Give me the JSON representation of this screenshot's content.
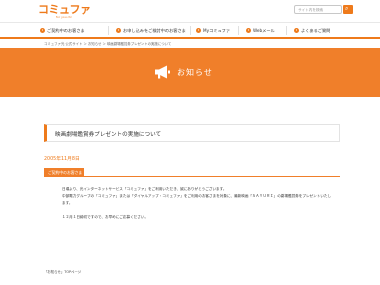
{
  "header": {
    "logo_text": "コミュファ",
    "logo_sub": "for you ctc",
    "search_placeholder": "サイト内を検索",
    "search_button_icon": "magnifier-icon"
  },
  "nav": {
    "items": [
      {
        "label": "ご契約中のお客さま"
      },
      {
        "label": "お申し込みをご検討中のお客さま"
      },
      {
        "label": "Myコミュファ"
      },
      {
        "label": "Webメール"
      },
      {
        "label": "よくあるご質問"
      }
    ]
  },
  "breadcrumb": "コミュファ光 公式サイト ＞ お知らせ ＞ 映画劇場鑑賞券プレゼントの実施について",
  "banner": {
    "title": "お知らせ",
    "icon": "megaphone-icon"
  },
  "article": {
    "title": "映画劇場鑑賞券プレゼントの実施について",
    "date": "2005年11月8日",
    "notice_label": "ご契約中のお客さま",
    "paragraphs": [
      "日頃より、光インターネットサービス「コミュファ」をご利用いただき、誠にありがとうございます。",
      "中部電力グループの「コミュファ」または「ダイヤルアップ・コミュファ」をご利用のお客さまを対象に、最新映画「ＳＡＹＵＲＩ」の劇場鑑賞券をプレゼントいたします。",
      "１２月１日締切ですので、お早めにご応募ください。"
    ]
  },
  "footer": {
    "link_text": "「お知らせ」TOPページ"
  },
  "colors": {
    "accent": "#ee7a1b",
    "banner": "#f07f2a"
  }
}
